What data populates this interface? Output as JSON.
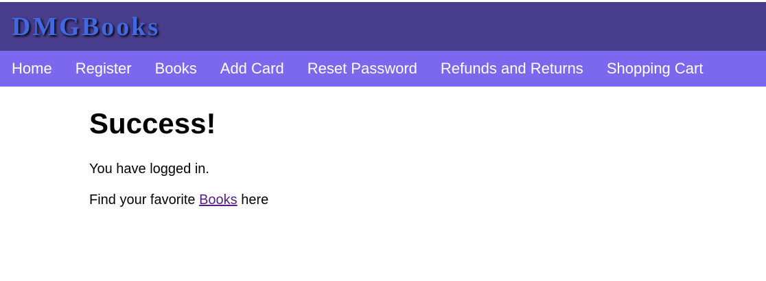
{
  "header": {
    "site_title": "DMGBooks"
  },
  "nav": {
    "items": [
      {
        "label": "Home"
      },
      {
        "label": "Register"
      },
      {
        "label": "Books"
      },
      {
        "label": "Add Card"
      },
      {
        "label": "Reset Password"
      },
      {
        "label": "Refunds and Returns"
      },
      {
        "label": "Shopping Cart"
      }
    ]
  },
  "main": {
    "heading": "Success!",
    "message": "You have logged in.",
    "find_prefix": "Find your favorite ",
    "books_link": "Books",
    "find_suffix": " here"
  },
  "colors": {
    "header_bg": "#483d8b",
    "title_color": "#4169e1",
    "nav_bg": "#7b68ee",
    "link_visited": "#551a8b"
  }
}
